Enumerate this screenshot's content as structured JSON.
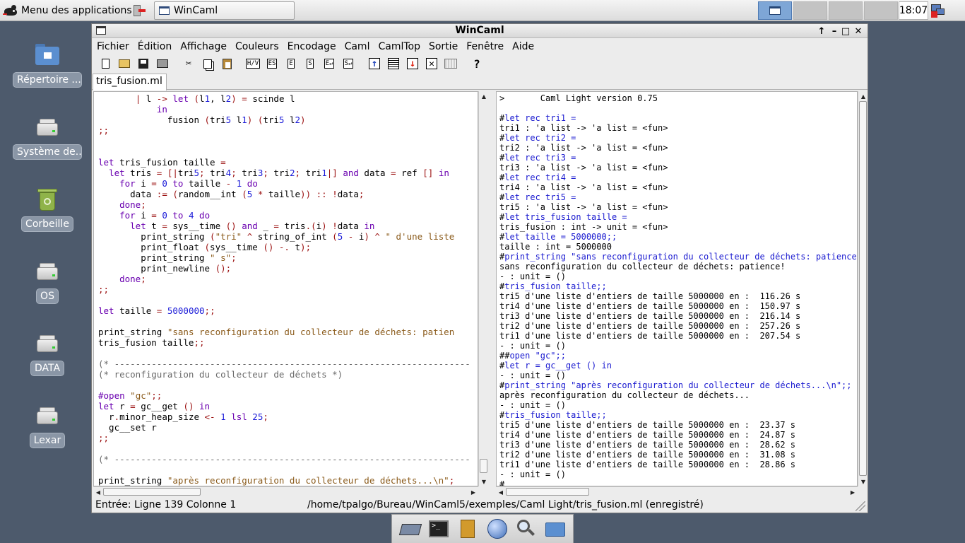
{
  "top_panel": {
    "apps_menu_label": "Menu des applications",
    "task_title": "WinCaml",
    "clock": "18:07"
  },
  "desktop": {
    "icons": [
      {
        "label": "Répertoire ...",
        "icon": "home-folder-icon"
      },
      {
        "label": "Système de...",
        "icon": "drive-icon"
      },
      {
        "label": "Corbeille",
        "icon": "trash-icon"
      },
      {
        "label": "OS",
        "icon": "drive-icon"
      },
      {
        "label": "DATA",
        "icon": "drive-icon"
      },
      {
        "label": "Lexar",
        "icon": "removable-drive-icon"
      }
    ]
  },
  "window": {
    "title": "WinCaml",
    "menus": [
      "Fichier",
      "Édition",
      "Affichage",
      "Couleurs",
      "Encodage",
      "Caml",
      "CamlTop",
      "Sortie",
      "Fenêtre",
      "Aide"
    ],
    "toolbar_text_buttons": [
      "H/V",
      "ES",
      "E",
      "S",
      "E↵",
      "S↵"
    ],
    "tab": "tris_fusion.ml",
    "editor_lines": [
      "       | l -> let (l1, l2) = scinde l",
      "           in",
      "             fusion (tri5 l1) (tri5 l2)",
      ";;",
      "",
      "",
      "let tris_fusion taille =",
      "  let tris = [|tri5; tri4; tri3; tri2; tri1|] and data = ref [] in",
      "    for i = 0 to taille - 1 do",
      "      data := (random__int (5 * taille)) :: !data;",
      "    done;",
      "    for i = 0 to 4 do",
      "      let t = sys__time () and _ = tris.(i) !data in",
      "        print_string (\"tri\" ^ string_of_int (5 - i) ^ \" d'une liste",
      "        print_float (sys__time () -. t);",
      "        print_string \" s\";",
      "        print_newline ();",
      "    done;",
      ";;",
      "",
      "let taille = 5000000;;",
      "",
      "print_string \"sans reconfiguration du collecteur de déchets: patien",
      "tris_fusion taille;;",
      "",
      "(* -------------------------------------------------------------------",
      "(* reconfiguration du collecteur de déchets *)",
      "",
      "#open \"gc\";;",
      "let r = gc__get () in",
      "  r.minor_heap_size <- 1 lsl 25;",
      "  gc__set r",
      ";;",
      "",
      "(* -------------------------------------------------------------------",
      "",
      "print_string \"après reconfiguration du collecteur de déchets...\\n\";"
    ],
    "console_lines": [
      ">       Caml Light version 0.75",
      "",
      "#let rec tri1 =",
      "tri1 : 'a list -> 'a list = <fun>",
      "#let rec tri2 =",
      "tri2 : 'a list -> 'a list = <fun>",
      "#let rec tri3 =",
      "tri3 : 'a list -> 'a list = <fun>",
      "#let rec tri4 =",
      "tri4 : 'a list -> 'a list = <fun>",
      "#let rec tri5 =",
      "tri5 : 'a list -> 'a list = <fun>",
      "#let tris_fusion taille =",
      "tris_fusion : int -> unit = <fun>",
      "#let taille = 5000000;;",
      "taille : int = 5000000",
      "#print_string \"sans reconfiguration du collecteur de déchets: patience!\\",
      "sans reconfiguration du collecteur de déchets: patience!",
      "- : unit = ()",
      "#tris_fusion taille;;",
      "tri5 d'une liste d'entiers de taille 5000000 en :  116.26 s",
      "tri4 d'une liste d'entiers de taille 5000000 en :  150.97 s",
      "tri3 d'une liste d'entiers de taille 5000000 en :  216.14 s",
      "tri2 d'une liste d'entiers de taille 5000000 en :  257.26 s",
      "tri1 d'une liste d'entiers de taille 5000000 en :  207.54 s",
      "- : unit = ()",
      "##open \"gc\";;",
      "#let r = gc__get () in",
      "- : unit = ()",
      "#print_string \"après reconfiguration du collecteur de déchets...\\n\";;",
      "après reconfiguration du collecteur de déchets...",
      "- : unit = ()",
      "#tris_fusion taille;;",
      "tri5 d'une liste d'entiers de taille 5000000 en :  23.37 s",
      "tri4 d'une liste d'entiers de taille 5000000 en :  24.87 s",
      "tri3 d'une liste d'entiers de taille 5000000 en :  28.62 s",
      "tri2 d'une liste d'entiers de taille 5000000 en :  31.08 s",
      "tri1 d'une liste d'entiers de taille 5000000 en :  28.86 s",
      "- : unit = ()",
      "#"
    ],
    "status_left": "Entrée:   Ligne 139 Colonne 1",
    "status_path": "/home/tpalgo/Bureau/WinCaml5/exemples/Caml Light/tris_fusion.ml (enregistré)"
  },
  "dock": {
    "items": [
      "desktop-icon",
      "terminal-icon",
      "file-cabinet-icon",
      "web-browser-icon",
      "search-icon",
      "folder-icon"
    ]
  }
}
